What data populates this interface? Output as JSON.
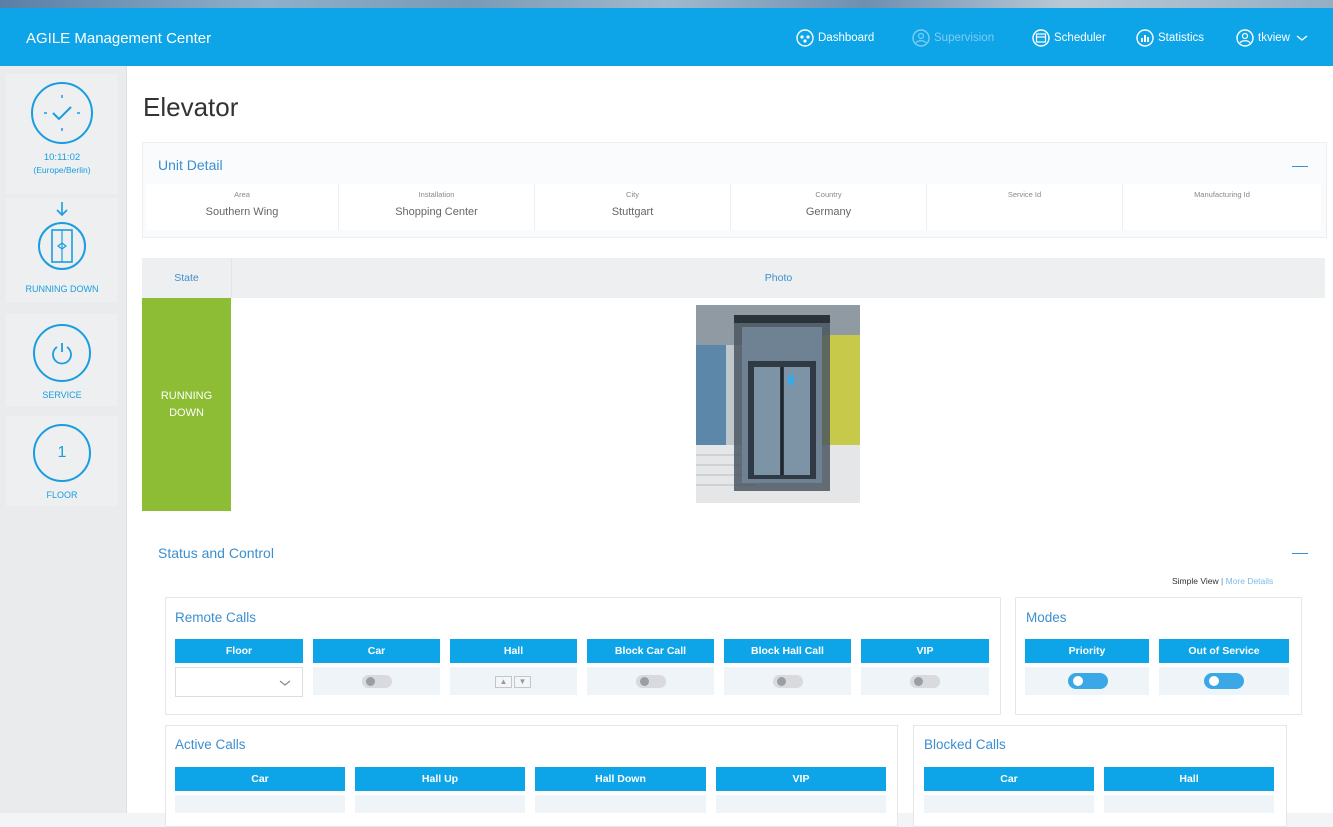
{
  "app": {
    "title": "AGILE Management Center"
  },
  "nav": [
    {
      "label": "Dashboard",
      "icon": "dashboard-icon",
      "active": true
    },
    {
      "label": "Supervision",
      "icon": "supervision-icon",
      "active": false
    },
    {
      "label": "Scheduler",
      "icon": "scheduler-icon",
      "active": true
    },
    {
      "label": "Statistics",
      "icon": "statistics-icon",
      "active": true
    },
    {
      "label": "tkview",
      "icon": "user-icon",
      "active": true
    }
  ],
  "sidebar": {
    "clock": {
      "time": "10:11:02",
      "timezone": "(Europe/Berlin)"
    },
    "elevator_state": "RUNNING DOWN",
    "service_label": "SERVICE",
    "floor": {
      "value": "1",
      "label": "FLOOR"
    }
  },
  "page": {
    "title": "Elevator"
  },
  "unit_detail": {
    "title": "Unit Detail",
    "fields": [
      {
        "label": "Area",
        "value": "Southern Wing"
      },
      {
        "label": "Installation",
        "value": "Shopping Center"
      },
      {
        "label": "City",
        "value": "Stuttgart"
      },
      {
        "label": "Country",
        "value": "Germany"
      },
      {
        "label": "Service Id",
        "value": ""
      },
      {
        "label": "Manufacturing Id",
        "value": ""
      }
    ]
  },
  "state_photo": {
    "state_header": "State",
    "photo_header": "Photo",
    "state_line1": "RUNNING",
    "state_line2": "DOWN"
  },
  "status_control": {
    "title": "Status and Control",
    "view_simple": "Simple View",
    "view_separator": "|",
    "view_more": "More Details",
    "remote_calls": {
      "title": "Remote Calls",
      "columns": [
        "Floor",
        "Car",
        "Hall",
        "Block Car Call",
        "Block Hall Call",
        "VIP"
      ]
    },
    "modes": {
      "title": "Modes",
      "columns": [
        "Priority",
        "Out of Service"
      ]
    },
    "active_calls": {
      "title": "Active Calls",
      "columns": [
        "Car",
        "Hall Up",
        "Hall Down",
        "VIP"
      ]
    },
    "blocked_calls": {
      "title": "Blocked Calls",
      "columns": [
        "Car",
        "Hall"
      ]
    }
  },
  "colors": {
    "primary": "#0da5e8",
    "state_running": "#8cbd34",
    "link": "#3b8fd0"
  }
}
